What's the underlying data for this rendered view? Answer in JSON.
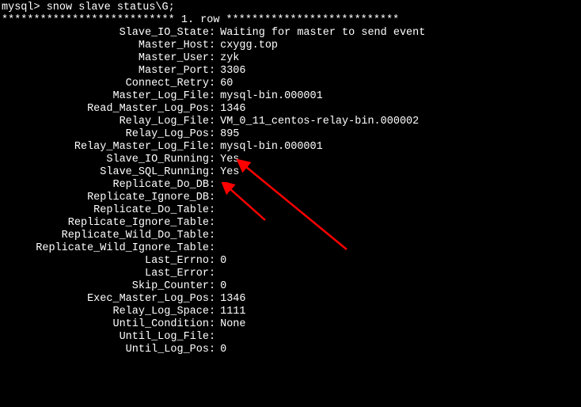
{
  "prompt_line": "mysql> snow slave status\\G;",
  "row_separator": "*************************** 1. row ***************************",
  "rows": [
    {
      "label": "Slave_IO_State",
      "value": "Waiting for master to send event"
    },
    {
      "label": "Master_Host",
      "value": "cxygg.top"
    },
    {
      "label": "Master_User",
      "value": "zyk"
    },
    {
      "label": "Master_Port",
      "value": "3306"
    },
    {
      "label": "Connect_Retry",
      "value": "60"
    },
    {
      "label": "Master_Log_File",
      "value": "mysql-bin.000001"
    },
    {
      "label": "Read_Master_Log_Pos",
      "value": "1346"
    },
    {
      "label": "Relay_Log_File",
      "value": "VM_0_11_centos-relay-bin.000002"
    },
    {
      "label": "Relay_Log_Pos",
      "value": "895"
    },
    {
      "label": "Relay_Master_Log_File",
      "value": "mysql-bin.000001"
    },
    {
      "label": "Slave_IO_Running",
      "value": "Yes"
    },
    {
      "label": "Slave_SQL_Running",
      "value": "Yes"
    },
    {
      "label": "Replicate_Do_DB",
      "value": ""
    },
    {
      "label": "Replicate_Ignore_DB",
      "value": ""
    },
    {
      "label": "Replicate_Do_Table",
      "value": ""
    },
    {
      "label": "Replicate_Ignore_Table",
      "value": ""
    },
    {
      "label": "Replicate_Wild_Do_Table",
      "value": ""
    },
    {
      "label": "Replicate_Wild_Ignore_Table",
      "value": ""
    },
    {
      "label": "Last_Errno",
      "value": "0"
    },
    {
      "label": "Last_Error",
      "value": ""
    },
    {
      "label": "Skip_Counter",
      "value": "0"
    },
    {
      "label": "Exec_Master_Log_Pos",
      "value": "1346"
    },
    {
      "label": "Relay_Log_Space",
      "value": "1111"
    },
    {
      "label": "Until_Condition",
      "value": "None"
    },
    {
      "label": "Until_Log_File",
      "value": ""
    },
    {
      "label": "Until_Log_Pos",
      "value": "0"
    }
  ],
  "highlight_indices": [
    10,
    11
  ],
  "arrow_color": "#ff0000"
}
